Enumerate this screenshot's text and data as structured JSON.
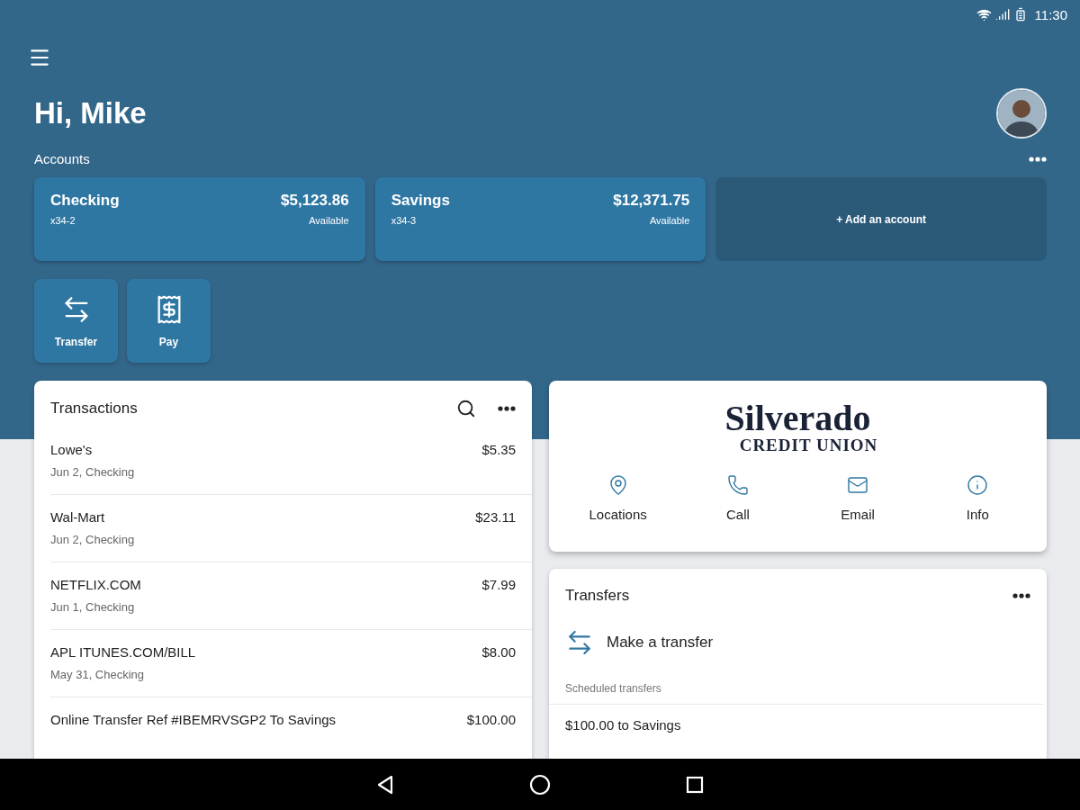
{
  "status_bar": {
    "time": "11:30"
  },
  "greeting": "Hi, Mike",
  "accounts_label": "Accounts",
  "accounts": [
    {
      "name": "Checking",
      "number": "x34-2",
      "balance": "$5,123.86",
      "balance_label": "Available"
    },
    {
      "name": "Savings",
      "number": "x34-3",
      "balance": "$12,371.75",
      "balance_label": "Available"
    }
  ],
  "add_account": "+ Add an account",
  "actions": [
    {
      "kind": "transfer",
      "label": "Transfer"
    },
    {
      "kind": "pay",
      "label": "Pay"
    }
  ],
  "transactions": {
    "title": "Transactions",
    "rows": [
      {
        "merchant": "Lowe's",
        "detail": "Jun 2, Checking",
        "amount": "$5.35"
      },
      {
        "merchant": "Wal-Mart",
        "detail": "Jun 2, Checking",
        "amount": "$23.11"
      },
      {
        "merchant": "NETFLIX.COM",
        "detail": "Jun 1, Checking",
        "amount": "$7.99"
      },
      {
        "merchant": "APL ITUNES.COM/BILL",
        "detail": "May 31, Checking",
        "amount": "$8.00"
      },
      {
        "merchant": "Online Transfer Ref #IBEMRVSGP2 To Savings",
        "amount": "$100.00"
      }
    ]
  },
  "institution": {
    "name": "Silverado",
    "subtitle": "CREDIT UNION",
    "contacts": [
      {
        "kind": "location",
        "label": "Locations"
      },
      {
        "kind": "call",
        "label": "Call"
      },
      {
        "kind": "email",
        "label": "Email"
      },
      {
        "kind": "info",
        "label": "Info"
      }
    ]
  },
  "transfers": {
    "title": "Transfers",
    "make_transfer": "Make a transfer",
    "scheduled_label": "Scheduled transfers",
    "scheduled": [
      "$100.00 to Savings"
    ]
  }
}
